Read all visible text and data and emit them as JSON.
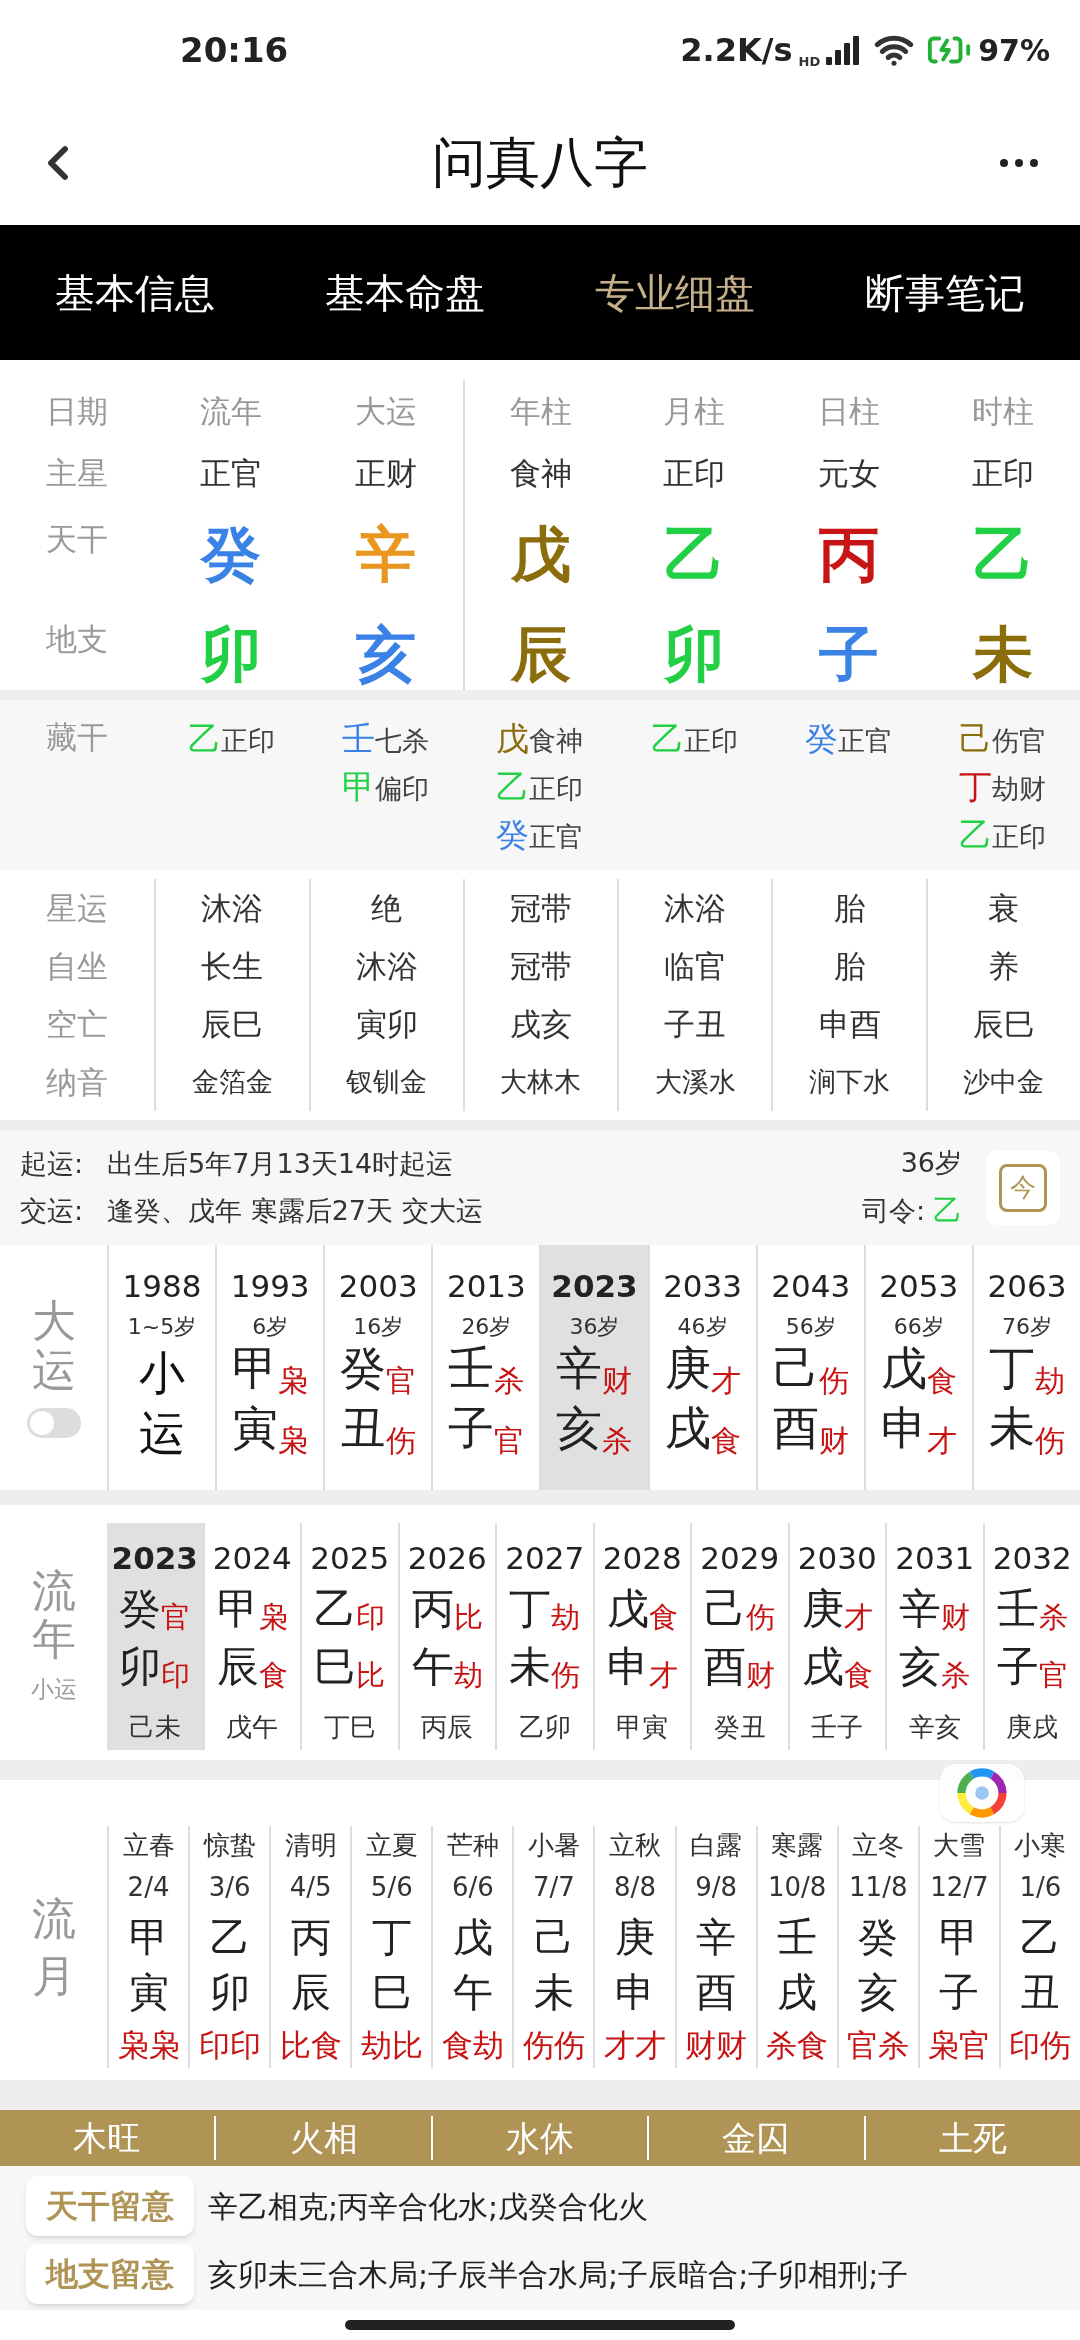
{
  "status_bar": {
    "time": "20:16",
    "speed": "2.2K/s",
    "hd": "HD",
    "battery": "97%"
  },
  "header": {
    "title": "问真八字"
  },
  "tabs": [
    {
      "label": "基本信息",
      "selected": false
    },
    {
      "label": "基本命盘",
      "selected": false
    },
    {
      "label": "专业细盘",
      "selected": true
    },
    {
      "label": "断事笔记",
      "selected": false
    }
  ],
  "pillars": {
    "row_labels": [
      "日期",
      "主星",
      "天干",
      "地支"
    ],
    "columns": [
      {
        "name": "流年",
        "star": "正官",
        "stem": {
          "char": "癸",
          "color": "#3b82e6"
        },
        "branch": {
          "char": "卯",
          "color": "#22d045"
        }
      },
      {
        "name": "大运",
        "star": "正财",
        "stem": {
          "char": "辛",
          "color": "#e8961e"
        },
        "branch": {
          "char": "亥",
          "color": "#3b82e6"
        }
      },
      {
        "name": "年柱",
        "star": "食神",
        "stem": {
          "char": "戊",
          "color": "#8b6d0c"
        },
        "branch": {
          "char": "辰",
          "color": "#8b6d0c"
        }
      },
      {
        "name": "月柱",
        "star": "正印",
        "stem": {
          "char": "乙",
          "color": "#22d045"
        },
        "branch": {
          "char": "卯",
          "color": "#22d045"
        }
      },
      {
        "name": "日柱",
        "star": "元女",
        "stem": {
          "char": "丙",
          "color": "#c81414"
        },
        "branch": {
          "char": "子",
          "color": "#3b82e6"
        }
      },
      {
        "name": "时柱",
        "star": "正印",
        "stem": {
          "char": "乙",
          "color": "#22d045"
        },
        "branch": {
          "char": "未",
          "color": "#8b6d0c"
        }
      }
    ]
  },
  "hidden_stems": {
    "label": "藏干",
    "columns": [
      [
        {
          "char": "乙",
          "color": "#22d045",
          "god": "正印"
        }
      ],
      [
        {
          "char": "壬",
          "color": "#3b82e6",
          "god": "七杀"
        },
        {
          "char": "甲",
          "color": "#22d045",
          "god": "偏印"
        }
      ],
      [
        {
          "char": "戊",
          "color": "#8b6d0c",
          "god": "食神"
        },
        {
          "char": "乙",
          "color": "#22d045",
          "god": "正印"
        },
        {
          "char": "癸",
          "color": "#3b82e6",
          "god": "正官"
        }
      ],
      [
        {
          "char": "乙",
          "color": "#22d045",
          "god": "正印"
        }
      ],
      [
        {
          "char": "癸",
          "color": "#3b82e6",
          "god": "正官"
        }
      ],
      [
        {
          "char": "己",
          "color": "#8b6d0c",
          "god": "伤官"
        },
        {
          "char": "丁",
          "color": "#c81414",
          "god": "劫财"
        },
        {
          "char": "乙",
          "color": "#22d045",
          "god": "正印"
        }
      ]
    ]
  },
  "stages": [
    {
      "label": "星运",
      "values": [
        "沐浴",
        "绝",
        "冠带",
        "沐浴",
        "胎",
        "衰"
      ]
    },
    {
      "label": "自坐",
      "values": [
        "长生",
        "沐浴",
        "冠带",
        "临官",
        "胎",
        "养"
      ]
    },
    {
      "label": "空亡",
      "values": [
        "辰巳",
        "寅卯",
        "戌亥",
        "子丑",
        "申酉",
        "辰巳"
      ]
    },
    {
      "label": "纳音",
      "values": [
        "金箔金",
        "钗钏金",
        "大林木",
        "大溪水",
        "涧下水",
        "沙中金"
      ]
    }
  ],
  "luck_start": {
    "start_label": "起运:",
    "start_text": "出生后5年7月13天14时起运",
    "hand_label": "交运:",
    "hand_text": "逢癸、戊年 寒露后27天 交大运",
    "age": "36岁",
    "commander_label": "司令:",
    "commander": {
      "char": "乙",
      "color": "#22d045"
    },
    "today_button": "今"
  },
  "dayun": {
    "title": "大运",
    "toggle_on": false,
    "items": [
      {
        "kind": "xiaoyun",
        "year": "1988",
        "age": "1~5岁",
        "stem": "小",
        "branch": "运",
        "selected": false
      },
      {
        "kind": "pillar",
        "year": "1993",
        "age": "6岁",
        "stem": "甲",
        "stem_god": "枭",
        "branch": "寅",
        "branch_god": "枭",
        "selected": false
      },
      {
        "kind": "pillar",
        "year": "2003",
        "age": "16岁",
        "stem": "癸",
        "stem_god": "官",
        "branch": "丑",
        "branch_god": "伤",
        "selected": false
      },
      {
        "kind": "pillar",
        "year": "2013",
        "age": "26岁",
        "stem": "壬",
        "stem_god": "杀",
        "branch": "子",
        "branch_god": "官",
        "selected": false
      },
      {
        "kind": "pillar",
        "year": "2023",
        "age": "36岁",
        "stem": "辛",
        "stem_god": "财",
        "branch": "亥",
        "branch_god": "杀",
        "selected": true
      },
      {
        "kind": "pillar",
        "year": "2033",
        "age": "46岁",
        "stem": "庚",
        "stem_god": "才",
        "branch": "戌",
        "branch_god": "食",
        "selected": false
      },
      {
        "kind": "pillar",
        "year": "2043",
        "age": "56岁",
        "stem": "己",
        "stem_god": "伤",
        "branch": "酉",
        "branch_god": "财",
        "selected": false
      },
      {
        "kind": "pillar",
        "year": "2053",
        "age": "66岁",
        "stem": "戊",
        "stem_god": "食",
        "branch": "申",
        "branch_god": "才",
        "selected": false
      },
      {
        "kind": "pillar",
        "year": "2063",
        "age": "76岁",
        "stem": "丁",
        "stem_god": "劫",
        "branch": "未",
        "branch_god": "伤",
        "selected": false
      }
    ]
  },
  "liunian": {
    "title": "流年",
    "subtitle": "小运",
    "items": [
      {
        "year": "2023",
        "stem": "癸",
        "stem_god": "官",
        "branch": "卯",
        "branch_god": "印",
        "xiaoyun": "己未",
        "selected": true
      },
      {
        "year": "2024",
        "stem": "甲",
        "stem_god": "枭",
        "branch": "辰",
        "branch_god": "食",
        "xiaoyun": "戊午",
        "selected": false
      },
      {
        "year": "2025",
        "stem": "乙",
        "stem_god": "印",
        "branch": "巳",
        "branch_god": "比",
        "xiaoyun": "丁巳",
        "selected": false
      },
      {
        "year": "2026",
        "stem": "丙",
        "stem_god": "比",
        "branch": "午",
        "branch_god": "劫",
        "xiaoyun": "丙辰",
        "selected": false
      },
      {
        "year": "2027",
        "stem": "丁",
        "stem_god": "劫",
        "branch": "未",
        "branch_god": "伤",
        "xiaoyun": "乙卯",
        "selected": false
      },
      {
        "year": "2028",
        "stem": "戊",
        "stem_god": "食",
        "branch": "申",
        "branch_god": "才",
        "xiaoyun": "甲寅",
        "selected": false
      },
      {
        "year": "2029",
        "stem": "己",
        "stem_god": "伤",
        "branch": "酉",
        "branch_god": "财",
        "xiaoyun": "癸丑",
        "selected": false
      },
      {
        "year": "2030",
        "stem": "庚",
        "stem_god": "才",
        "branch": "戌",
        "branch_god": "食",
        "xiaoyun": "壬子",
        "selected": false
      },
      {
        "year": "2031",
        "stem": "辛",
        "stem_god": "财",
        "branch": "亥",
        "branch_god": "杀",
        "xiaoyun": "辛亥",
        "selected": false
      },
      {
        "year": "2032",
        "stem": "壬",
        "stem_god": "杀",
        "branch": "子",
        "branch_god": "官",
        "xiaoyun": "庚戌",
        "selected": false
      }
    ]
  },
  "liuyue": {
    "title": "流月",
    "items": [
      {
        "term": "立春",
        "date": "2/4",
        "stem": "甲",
        "branch": "寅",
        "gods": "枭枭"
      },
      {
        "term": "惊蛰",
        "date": "3/6",
        "stem": "乙",
        "branch": "卯",
        "gods": "印印"
      },
      {
        "term": "清明",
        "date": "4/5",
        "stem": "丙",
        "branch": "辰",
        "gods": "比食"
      },
      {
        "term": "立夏",
        "date": "5/6",
        "stem": "丁",
        "branch": "巳",
        "gods": "劫比"
      },
      {
        "term": "芒种",
        "date": "6/6",
        "stem": "戊",
        "branch": "午",
        "gods": "食劫"
      },
      {
        "term": "小暑",
        "date": "7/7",
        "stem": "己",
        "branch": "未",
        "gods": "伤伤"
      },
      {
        "term": "立秋",
        "date": "8/8",
        "stem": "庚",
        "branch": "申",
        "gods": "才才"
      },
      {
        "term": "白露",
        "date": "9/8",
        "stem": "辛",
        "branch": "酉",
        "gods": "财财"
      },
      {
        "term": "寒露",
        "date": "10/8",
        "stem": "壬",
        "branch": "戌",
        "gods": "杀食"
      },
      {
        "term": "立冬",
        "date": "11/8",
        "stem": "癸",
        "branch": "亥",
        "gods": "官杀"
      },
      {
        "term": "大雪",
        "date": "12/7",
        "stem": "甲",
        "branch": "子",
        "gods": "枭官"
      },
      {
        "term": "小寒",
        "date": "1/6",
        "stem": "乙",
        "branch": "丑",
        "gods": "印伤"
      }
    ]
  },
  "phases": [
    "木旺",
    "火相",
    "水休",
    "金囚",
    "土死"
  ],
  "notes": [
    {
      "label": "天干留意",
      "text": "辛乙相克;丙辛合化水;戊癸合化火"
    },
    {
      "label": "地支留意",
      "text": "亥卯未三合木局;子辰半合水局;子辰暗合;子卯相刑;子"
    }
  ]
}
